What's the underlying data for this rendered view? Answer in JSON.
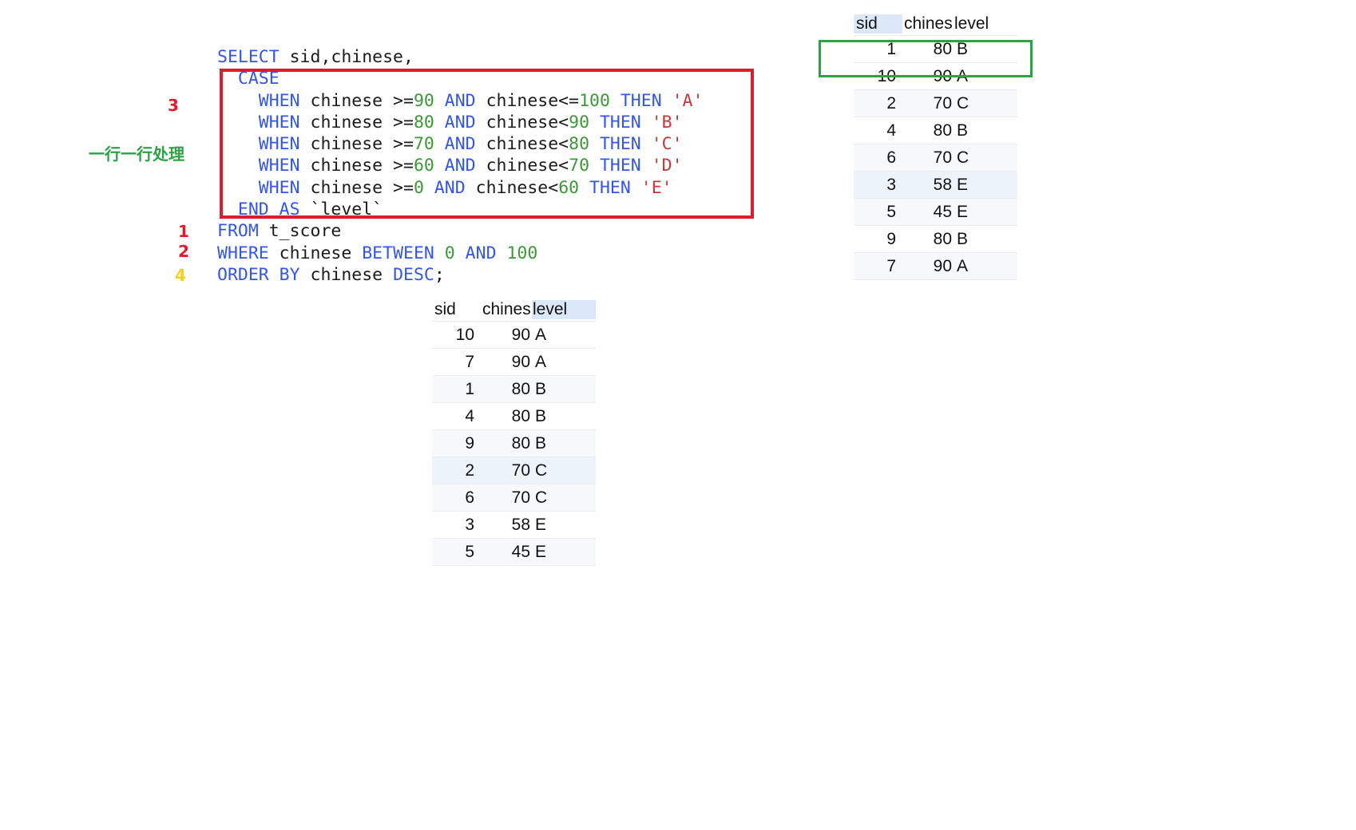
{
  "sql": {
    "lines": [
      [
        {
          "t": "SELECT",
          "c": "kw"
        },
        {
          "t": " sid,chinese,",
          "c": "idt"
        }
      ],
      [
        {
          "t": "  CASE",
          "c": "kw"
        }
      ],
      [
        {
          "t": "    WHEN",
          "c": "kw"
        },
        {
          "t": " chinese >=",
          "c": "idt"
        },
        {
          "t": "90",
          "c": "num"
        },
        {
          "t": " AND",
          "c": "kw"
        },
        {
          "t": " chinese<=",
          "c": "idt"
        },
        {
          "t": "100",
          "c": "num"
        },
        {
          "t": " THEN",
          "c": "kw"
        },
        {
          "t": " 'A'",
          "c": "str"
        }
      ],
      [
        {
          "t": "    WHEN",
          "c": "kw"
        },
        {
          "t": " chinese >=",
          "c": "idt"
        },
        {
          "t": "80",
          "c": "num"
        },
        {
          "t": " AND",
          "c": "kw"
        },
        {
          "t": " chinese<",
          "c": "idt"
        },
        {
          "t": "90",
          "c": "num"
        },
        {
          "t": " THEN",
          "c": "kw"
        },
        {
          "t": " 'B'",
          "c": "str"
        }
      ],
      [
        {
          "t": "    WHEN",
          "c": "kw"
        },
        {
          "t": " chinese >=",
          "c": "idt"
        },
        {
          "t": "70",
          "c": "num"
        },
        {
          "t": " AND",
          "c": "kw"
        },
        {
          "t": " chinese<",
          "c": "idt"
        },
        {
          "t": "80",
          "c": "num"
        },
        {
          "t": " THEN",
          "c": "kw"
        },
        {
          "t": " 'C'",
          "c": "str"
        }
      ],
      [
        {
          "t": "    WHEN",
          "c": "kw"
        },
        {
          "t": " chinese >=",
          "c": "idt"
        },
        {
          "t": "60",
          "c": "num"
        },
        {
          "t": " AND",
          "c": "kw"
        },
        {
          "t": " chinese<",
          "c": "idt"
        },
        {
          "t": "70",
          "c": "num"
        },
        {
          "t": " THEN",
          "c": "kw"
        },
        {
          "t": " 'D'",
          "c": "str"
        }
      ],
      [
        {
          "t": "    WHEN",
          "c": "kw"
        },
        {
          "t": " chinese >=",
          "c": "idt"
        },
        {
          "t": "0",
          "c": "num"
        },
        {
          "t": " AND",
          "c": "kw"
        },
        {
          "t": " chinese<",
          "c": "idt"
        },
        {
          "t": "60",
          "c": "num"
        },
        {
          "t": " THEN",
          "c": "kw"
        },
        {
          "t": " 'E'",
          "c": "str"
        }
      ],
      [
        {
          "t": "  END AS",
          "c": "kw"
        },
        {
          "t": " `level`",
          "c": "idt"
        }
      ],
      [
        {
          "t": "FROM",
          "c": "kw"
        },
        {
          "t": " t_score",
          "c": "idt"
        }
      ],
      [
        {
          "t": "WHERE",
          "c": "kw"
        },
        {
          "t": " chinese ",
          "c": "idt"
        },
        {
          "t": "BETWEEN",
          "c": "kw"
        },
        {
          "t": " 0",
          "c": "num"
        },
        {
          "t": " AND",
          "c": "kw"
        },
        {
          "t": " 100",
          "c": "num"
        }
      ],
      [
        {
          "t": "ORDER BY",
          "c": "kw"
        },
        {
          "t": " chinese ",
          "c": "idt"
        },
        {
          "t": "DESC",
          "c": "kw"
        },
        {
          "t": ";",
          "c": "idt"
        }
      ]
    ]
  },
  "annotations": {
    "step3": "3",
    "row_by_row": "一行一行处理",
    "step1": "1",
    "step2": "2",
    "step4": "4"
  },
  "colors": {
    "keyword": "#3355ee",
    "number": "#3a9a34",
    "string": "#c33838",
    "case_box": "#e21b2c",
    "row_box": "#2aa342"
  },
  "table_unsorted": {
    "columns": [
      "sid",
      "chines",
      "level"
    ],
    "rows": [
      [
        "1",
        "80",
        "B"
      ],
      [
        "10",
        "90",
        "A"
      ],
      [
        "2",
        "70",
        "C"
      ],
      [
        "4",
        "80",
        "B"
      ],
      [
        "6",
        "70",
        "C"
      ],
      [
        "3",
        "58",
        "E"
      ],
      [
        "5",
        "45",
        "E"
      ],
      [
        "9",
        "80",
        "B"
      ],
      [
        "7",
        "90",
        "A"
      ]
    ]
  },
  "table_sorted": {
    "columns": [
      "sid",
      "chines",
      "level"
    ],
    "rows": [
      [
        "10",
        "90",
        "A"
      ],
      [
        "7",
        "90",
        "A"
      ],
      [
        "1",
        "80",
        "B"
      ],
      [
        "4",
        "80",
        "B"
      ],
      [
        "9",
        "80",
        "B"
      ],
      [
        "2",
        "70",
        "C"
      ],
      [
        "6",
        "70",
        "C"
      ],
      [
        "3",
        "58",
        "E"
      ],
      [
        "5",
        "45",
        "E"
      ]
    ]
  }
}
